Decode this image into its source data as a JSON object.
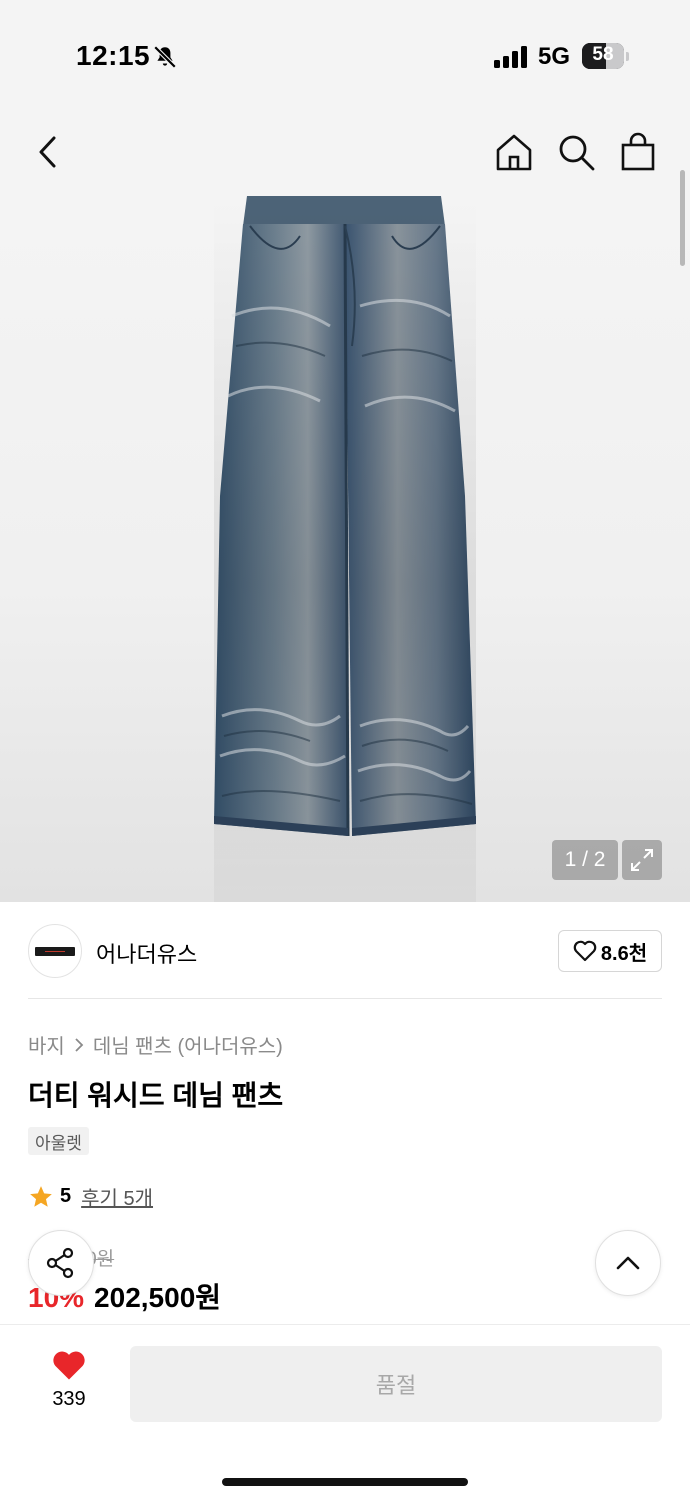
{
  "status_bar": {
    "time": "12:15",
    "network": "5G",
    "battery": "58"
  },
  "nav": {
    "icons": [
      "back-icon",
      "home-icon",
      "search-icon",
      "shopping-bag-icon"
    ]
  },
  "gallery": {
    "counter": "1 / 2"
  },
  "brand": {
    "name": "어나더유스",
    "likes": "8.6천"
  },
  "breadcrumb": {
    "category": "바지",
    "subcategory": "데님 팬츠 (어나더유스)"
  },
  "product": {
    "title": "더티 워시드 데님 팬츠",
    "tag": "아울렛",
    "rating": "5",
    "reviews": "후기 5개",
    "original_price": "225,000원",
    "discount": "10%",
    "price": "202,500원"
  },
  "bottom": {
    "wish_count": "339",
    "buy_label": "품절"
  },
  "colors": {
    "accent_red": "#e8262a",
    "star": "#f5a623"
  }
}
